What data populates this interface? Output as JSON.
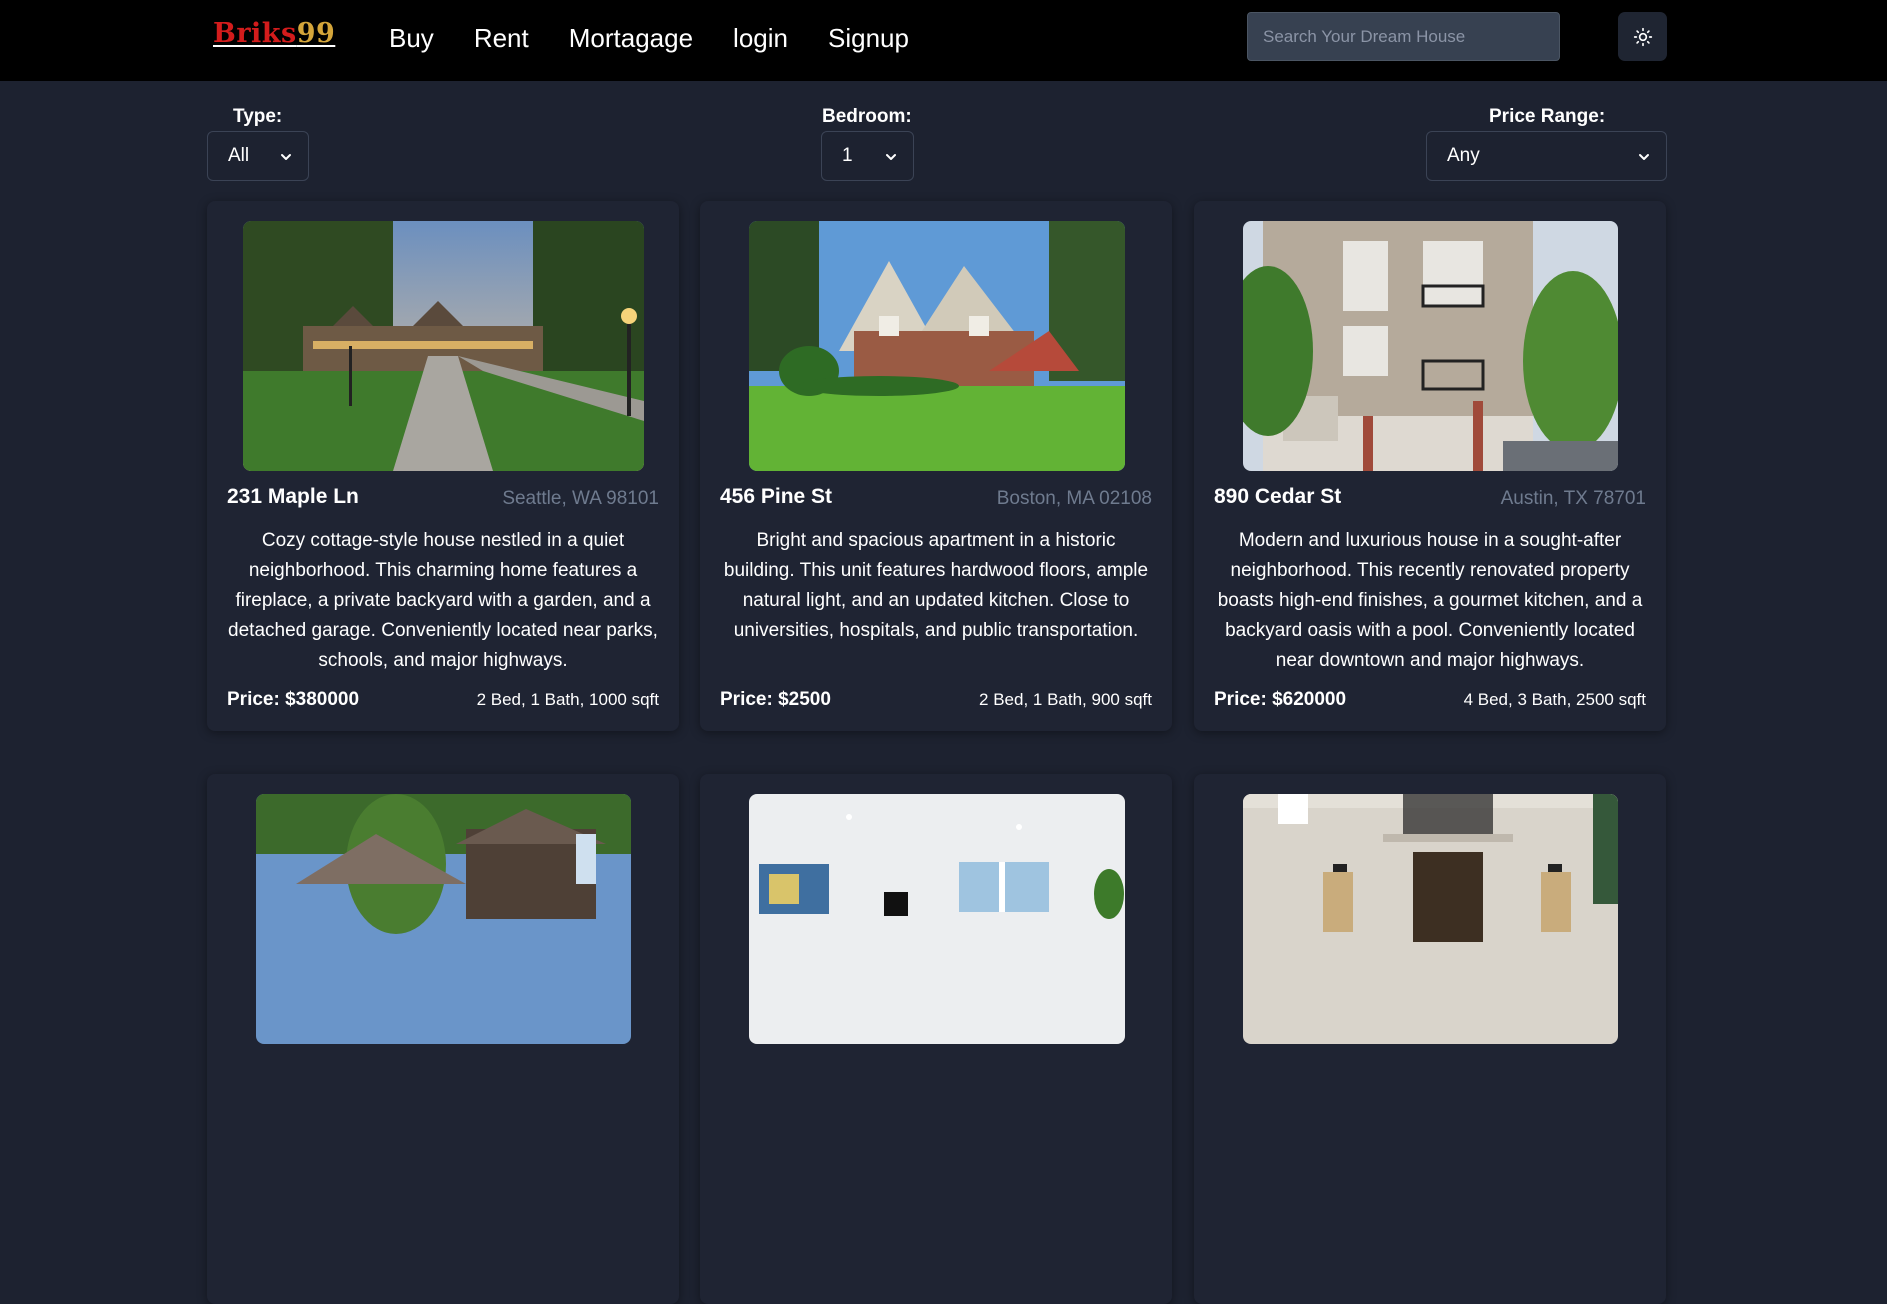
{
  "navbar": {
    "logo_brand": "Briks",
    "logo_number": "99",
    "links": [
      "Buy",
      "Rent",
      "Mortagage",
      "login",
      "Signup"
    ],
    "search_placeholder": "Search Your Dream House",
    "theme_icon": "sun-icon"
  },
  "filters": {
    "type": {
      "label": "Type:",
      "value": "All"
    },
    "bedroom": {
      "label": "Bedroom:",
      "value": "1"
    },
    "price_range": {
      "label": "Price Range:",
      "value": "Any"
    }
  },
  "listings": [
    {
      "address": "231 Maple Ln",
      "city": "Seattle, WA 98101",
      "description": "Cozy cottage-style house nestled in a quiet neighborhood. This charming home features a fireplace, a private backyard with a garden, and a detached garage. Conveniently located near parks, schools, and major highways.",
      "price": "Price: $380000",
      "details": "2 Bed, 1 Bath, 1000 sqft"
    },
    {
      "address": "456 Pine St",
      "city": "Boston, MA 02108",
      "description": "Bright and spacious apartment in a historic building. This unit features hardwood floors, ample natural light, and an updated kitchen. Close to universities, hospitals, and public transportation.",
      "price": "Price: $2500",
      "details": "2 Bed, 1 Bath, 900 sqft"
    },
    {
      "address": "890 Cedar St",
      "city": "Austin, TX 78701",
      "description": "Modern and luxurious house in a sought-after neighborhood. This recently renovated property boasts high-end finishes, a gourmet kitchen, and a backyard oasis with a pool. Conveniently located near downtown and major highways.",
      "price": "Price: $620000",
      "details": "4 Bed, 3 Bath, 2500 sqft"
    }
  ],
  "colors": {
    "background": "#1d2230",
    "navbar": "#000000",
    "card": "#1f2433",
    "logo_brand": "#d31c1c",
    "logo_number": "#d4a53a",
    "muted_text": "#6f7b8f"
  }
}
